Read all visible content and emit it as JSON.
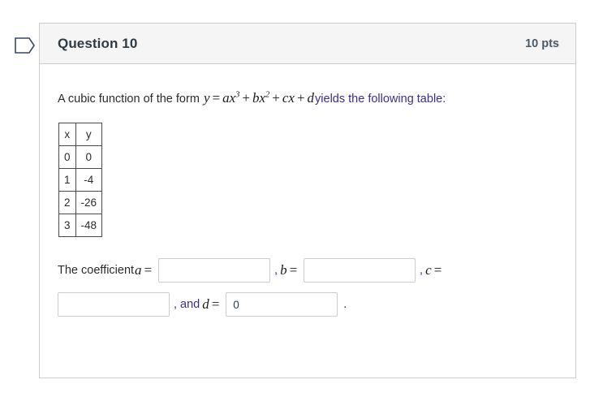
{
  "flag": {
    "icon": "flag-outline-icon"
  },
  "question": {
    "title": "Question 10",
    "points": "10 pts",
    "prompt": {
      "lead": "A cubic function of the form",
      "formula": {
        "y": "y",
        "eq": "=",
        "a": "a",
        "x1": "x",
        "exp1": "3",
        "plus1": "+",
        "b": "b",
        "x2": "x",
        "exp2": "2",
        "plus2": "+",
        "c": "c",
        "x3": "x",
        "plus3": "+",
        "d": "d"
      },
      "tail": "yields the following table:"
    }
  },
  "table": {
    "headers": [
      "x",
      "y"
    ],
    "rows": [
      [
        "0",
        "0"
      ],
      [
        "1",
        "-4"
      ],
      [
        "2",
        "-26"
      ],
      [
        "3",
        "-48"
      ]
    ]
  },
  "answers": {
    "lead_label": "The coefficient",
    "var_a": "a",
    "eq_a": "=",
    "value_a": "",
    "sep_b": ",",
    "var_b": "b",
    "eq_b": "=",
    "value_b": "",
    "sep_c": ",",
    "var_c": "c",
    "eq_c": "=",
    "value_c": "",
    "sep_d": ", and",
    "var_d": "d",
    "eq_d": "=",
    "value_d": "0",
    "period": ".",
    "placeholder": ""
  },
  "colors": {
    "accent_purple": "#3b2d8f",
    "header_bg": "#f5f5f5",
    "border": "#c7cdd1",
    "text": "#2b2b2b"
  }
}
